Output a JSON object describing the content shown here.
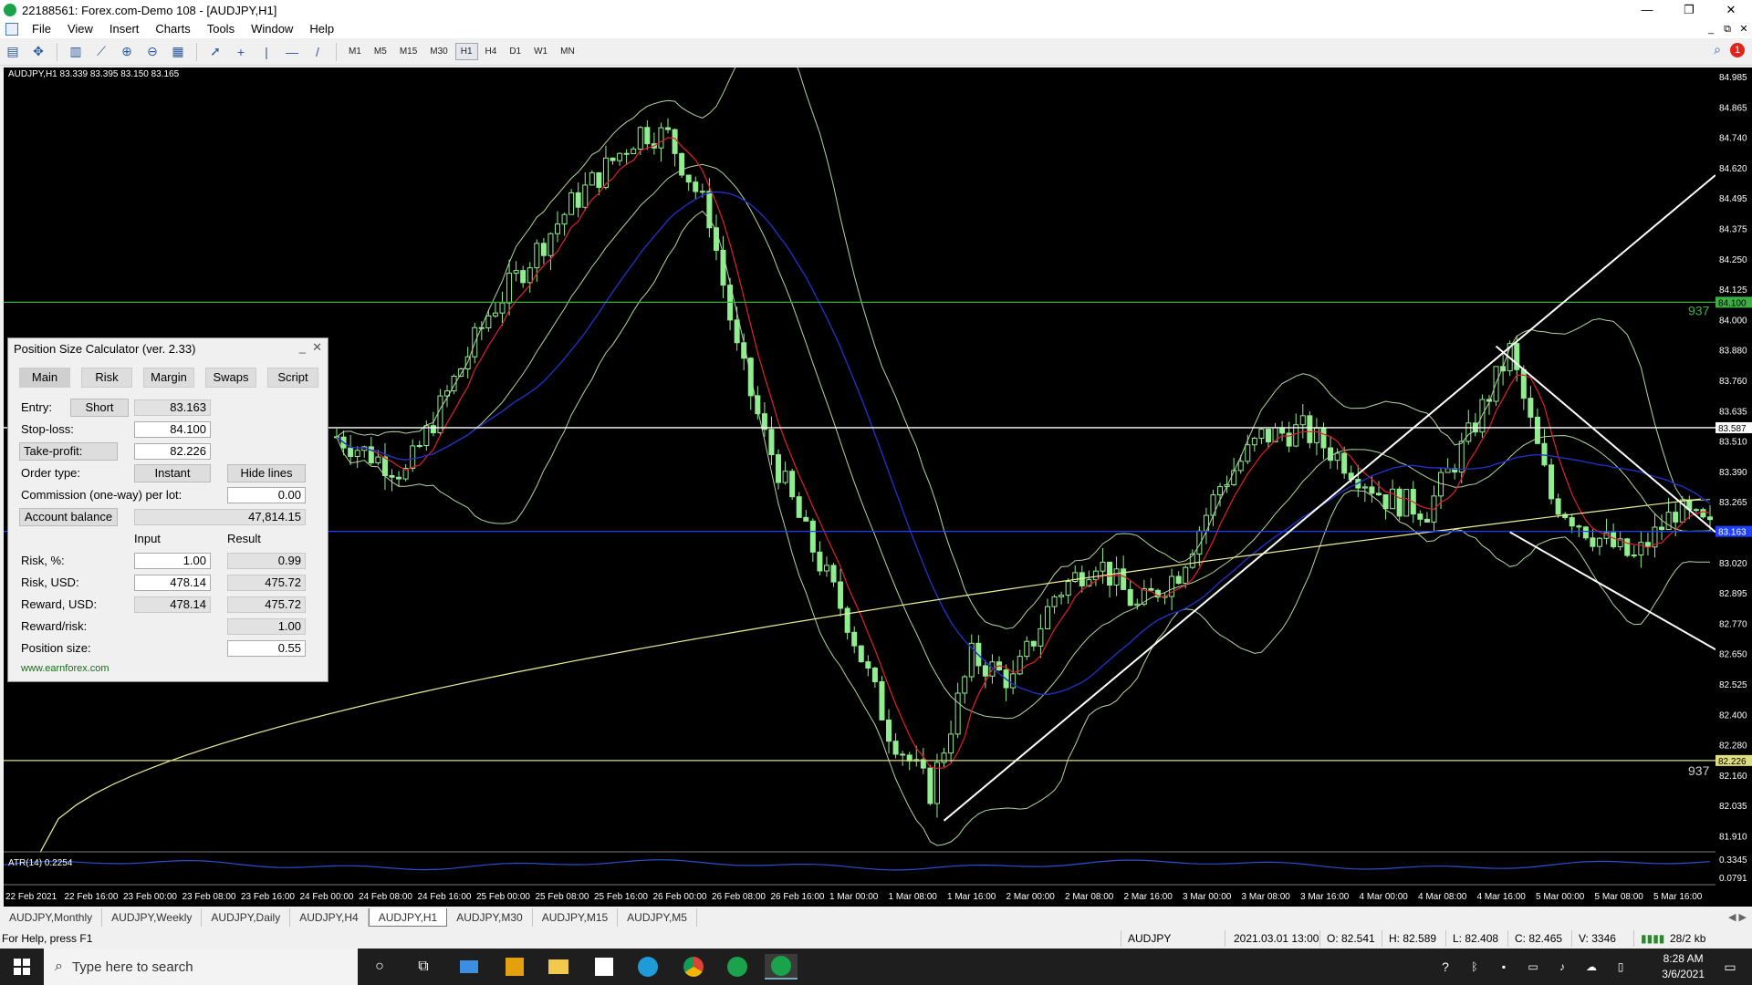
{
  "window": {
    "title": "22188561: Forex.com-Demo 108 - [AUDJPY,H1]",
    "min": "—",
    "max": "❐",
    "close": "✕"
  },
  "menu": [
    "File",
    "View",
    "Insert",
    "Charts",
    "Tools",
    "Window",
    "Help"
  ],
  "mdi": {
    "min": "_",
    "restore": "⧉",
    "close": "✕"
  },
  "toolbar": {
    "timeframes": [
      "M1",
      "M5",
      "M15",
      "M30",
      "H1",
      "H4",
      "D1",
      "W1",
      "MN"
    ],
    "active": "H1",
    "alert_count": "1"
  },
  "chart": {
    "header": "AUDJPY,H1  83.339 83.395 83.150 83.165",
    "atr_label": "ATR(14) 0.2254",
    "line_label_top": "937",
    "line_label_bottom": "937",
    "price_ticks": [
      "84.985",
      "84.865",
      "84.740",
      "84.620",
      "84.495",
      "84.375",
      "84.250",
      "84.125",
      "84.000",
      "83.880",
      "83.760",
      "83.635",
      "83.510",
      "83.390",
      "83.265",
      "83.140",
      "83.020",
      "82.895",
      "82.770",
      "82.650",
      "82.525",
      "82.400",
      "82.280",
      "82.160",
      "82.035",
      "81.910"
    ],
    "tp_level": "84.100",
    "entry_level": "83.587",
    "sl_level": "83.163",
    "bottom_level": "82.226",
    "atr_ticks": [
      "0.3345",
      "0.0791"
    ],
    "time_ticks": [
      "22 Feb 2021",
      "22 Feb 16:00",
      "23 Feb 00:00",
      "23 Feb 08:00",
      "23 Feb 16:00",
      "24 Feb 00:00",
      "24 Feb 08:00",
      "24 Feb 16:00",
      "25 Feb 00:00",
      "25 Feb 08:00",
      "25 Feb 16:00",
      "26 Feb 00:00",
      "26 Feb 08:00",
      "26 Feb 16:00",
      "1 Mar 00:00",
      "1 Mar 08:00",
      "1 Mar 16:00",
      "2 Mar 00:00",
      "2 Mar 08:00",
      "2 Mar 16:00",
      "3 Mar 00:00",
      "3 Mar 08:00",
      "3 Mar 16:00",
      "4 Mar 00:00",
      "4 Mar 08:00",
      "4 Mar 16:00",
      "5 Mar 00:00",
      "5 Mar 08:00",
      "5 Mar 16:00"
    ]
  },
  "psc": {
    "title": "Position Size Calculator (ver. 2.33)",
    "tabs": [
      "Main",
      "Risk",
      "Margin",
      "Swaps",
      "Script"
    ],
    "entry_label": "Entry:",
    "short_btn": "Short",
    "entry": "83.163",
    "sl_label": "Stop-loss:",
    "sl": "84.100",
    "tp_btn": "Take-profit:",
    "tp": "82.226",
    "order_label": "Order type:",
    "order_btn": "Instant",
    "hide_btn": "Hide lines",
    "comm_label": "Commission (one-way) per lot:",
    "comm": "0.00",
    "balance_btn": "Account balance",
    "balance": "47,814.15",
    "col_input": "Input",
    "col_result": "Result",
    "risk_pct_label": "Risk, %:",
    "risk_pct_in": "1.00",
    "risk_pct_out": "0.99",
    "risk_usd_label": "Risk, USD:",
    "risk_usd_in": "478.14",
    "risk_usd_out": "475.72",
    "reward_label": "Reward, USD:",
    "reward_in": "478.14",
    "reward_out": "475.72",
    "rr_label": "Reward/risk:",
    "rr": "1.00",
    "pos_label": "Position size:",
    "pos": "0.55",
    "link": "www.earnforex.com"
  },
  "symtabs": [
    "AUDJPY,Monthly",
    "AUDJPY,Weekly",
    "AUDJPY,Daily",
    "AUDJPY,H4",
    "AUDJPY,H1",
    "AUDJPY,M30",
    "AUDJPY,M15",
    "AUDJPY,M5"
  ],
  "symtab_active": "AUDJPY,H1",
  "status": {
    "help": "For Help, press F1",
    "symbol": "AUDJPY",
    "time": "2021.03.01 13:00",
    "open": "O: 82.541",
    "high": "H: 82.589",
    "low": "L: 82.408",
    "close": "C: 82.465",
    "volume": "V: 3346",
    "traffic": "28/2 kb"
  },
  "taskbar": {
    "search_placeholder": "Type here to search",
    "time": "8:28 AM",
    "date": "3/6/2021"
  },
  "colors": {
    "candle": "#90ee90",
    "ma_red": "#e0202a",
    "ma_blue": "#2030c0",
    "ma_yellow": "#eeee99",
    "band": "#b0d8a0",
    "level_green": "#3cb043",
    "level_blue": "#2040ff",
    "level_yellow": "#dede80"
  }
}
